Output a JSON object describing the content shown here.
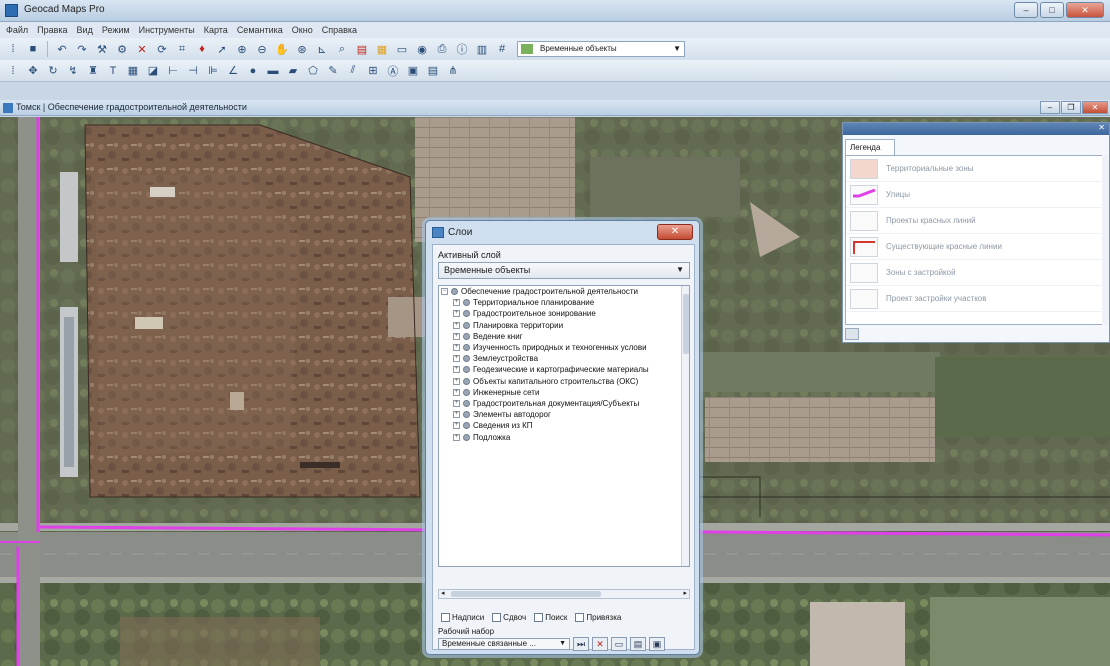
{
  "app": {
    "title": "Geocad Maps Pro"
  },
  "menu": [
    "Файл",
    "Правка",
    "Вид",
    "Режим",
    "Инструменты",
    "Карта",
    "Семантика",
    "Окно",
    "Справка"
  ],
  "toolbar": {
    "active_layer": "Временные объекты"
  },
  "document": {
    "title": "Томск | Обеспечение градостроительной деятельности"
  },
  "dialog": {
    "title": "Слои",
    "close_label": "✕",
    "active_layer_label": "Активный слой",
    "active_layer_value": "Временные объекты",
    "tree": [
      "Обеспечение градостроительной деятельности",
      "Территориальное планирование",
      "Градостроительное зонирование",
      "Планировка территории",
      "Ведение книг",
      "Изученность природных и техногенных услови",
      "Землеустройства",
      "Геодезические и картографические материалы",
      "Объекты капитального строительства (ОКС)",
      "Инженерные сети",
      "Градостроительная документация/Субъекты",
      "Элементы автодорог",
      "Сведения из КП",
      "Подложка"
    ],
    "checkboxes": [
      "Надписи",
      "Сдвоч",
      "Поиск",
      "Привязка"
    ],
    "work_set_label": "Рабочий набор",
    "work_set_value": "Временные связанные ..."
  },
  "legend": {
    "tab": "Легенда",
    "items": [
      "Территориальные зоны",
      "Улицы",
      "Проекты красных линий",
      "Существующие красные линии",
      "Зоны с застройкой",
      "Проект застройки участков"
    ]
  }
}
